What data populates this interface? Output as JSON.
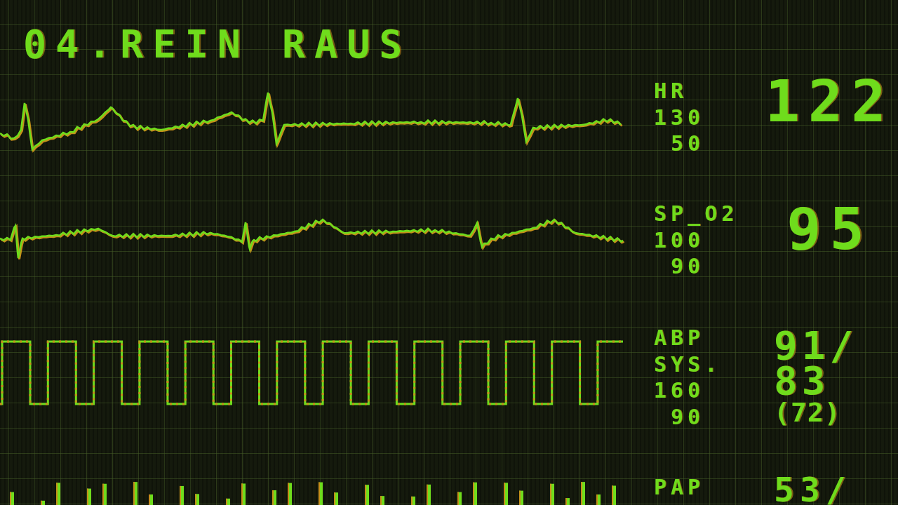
{
  "title": "04.REIN RAUS",
  "channels": [
    {
      "kind": "ecg",
      "label": "HR",
      "limits": [
        "130",
        "50"
      ],
      "readings": [
        "122"
      ]
    },
    {
      "kind": "pleth",
      "label": "SP_O2",
      "limits": [
        "100",
        "90"
      ],
      "readings": [
        "95"
      ]
    },
    {
      "kind": "square",
      "label": "ABP",
      "sublabel": "SYS.",
      "limits": [
        "160",
        "90"
      ],
      "readings": [
        "91/",
        "83",
        "(72)"
      ]
    },
    {
      "kind": "bars",
      "label": "PAP",
      "readings": [
        "53/"
      ]
    }
  ]
}
